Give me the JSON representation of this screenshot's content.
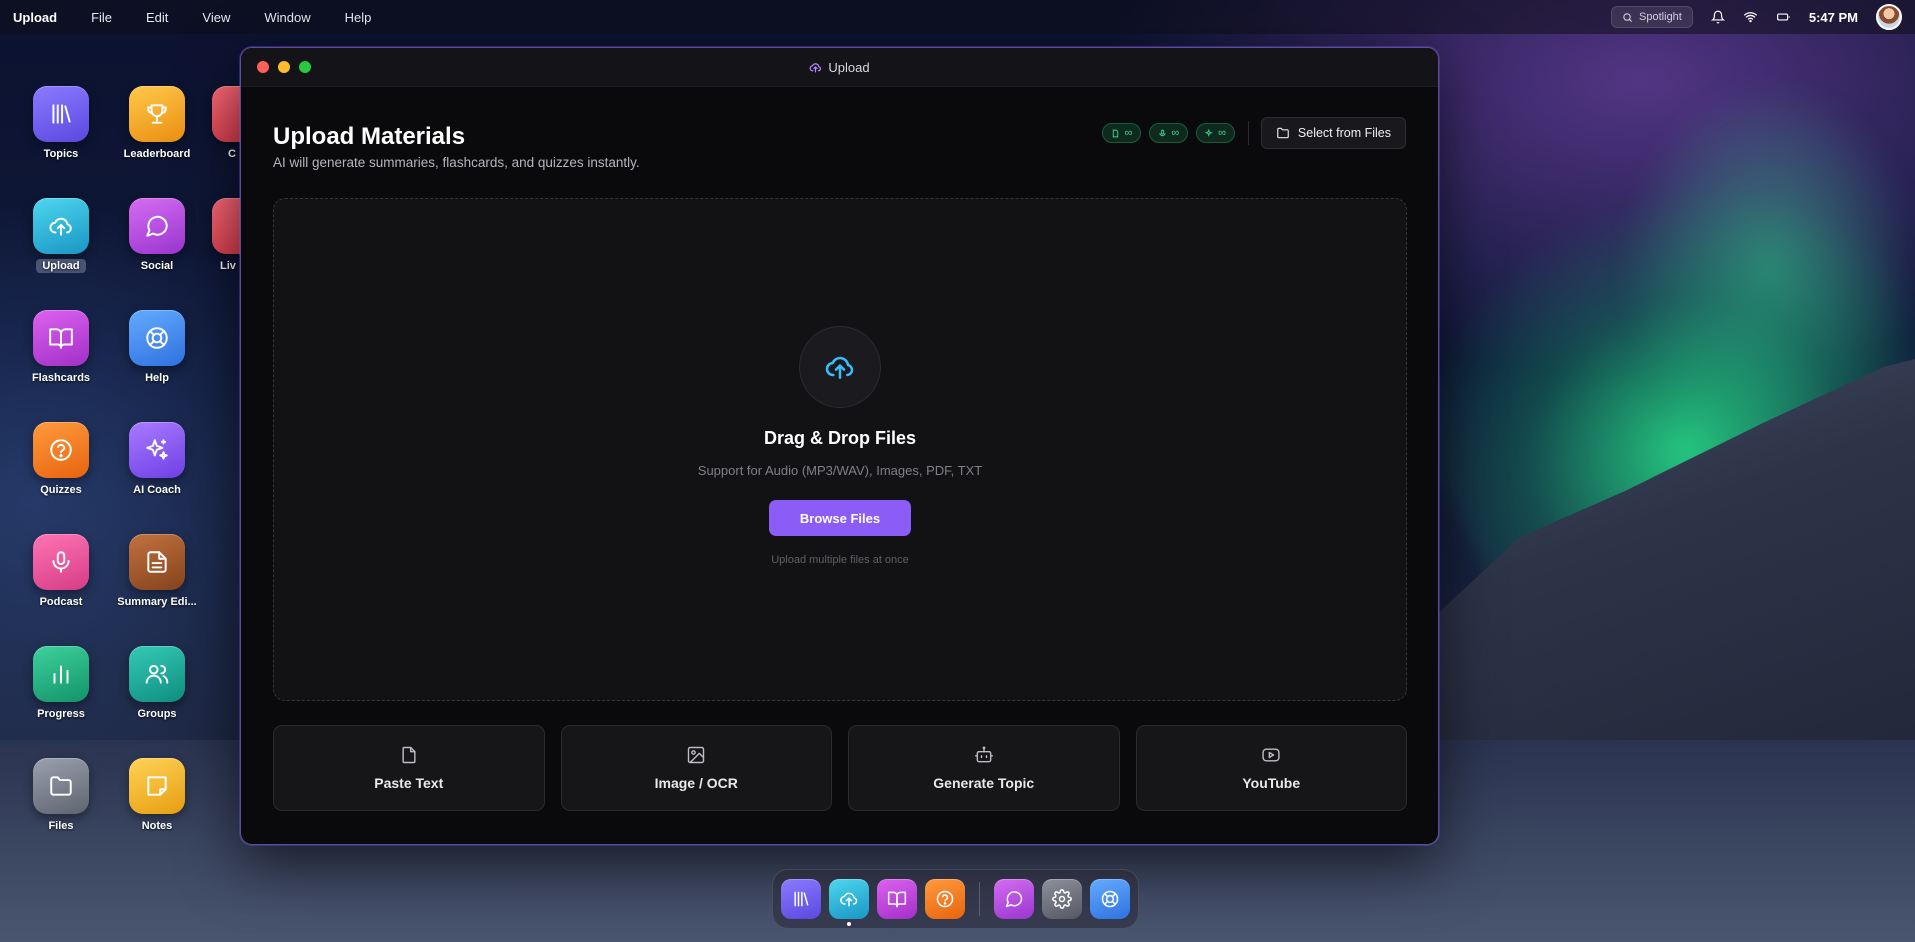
{
  "menubar": {
    "app_name": "Upload",
    "menus": [
      "File",
      "Edit",
      "View",
      "Window",
      "Help"
    ],
    "spotlight_placeholder": "Spotlight",
    "clock": "5:47 PM"
  },
  "desktop_icons": [
    {
      "label": "Topics",
      "icon": "library-icon",
      "color": "#6d5df0"
    },
    {
      "label": "Leaderboard",
      "icon": "trophy-icon",
      "color": "#f2a922"
    },
    {
      "label": "Upload",
      "icon": "cloud-upload-icon",
      "color": "#22b5d9",
      "selected": true
    },
    {
      "label": "Social",
      "icon": "chat-icon",
      "color": "#b84be0"
    },
    {
      "label": "Flashcards",
      "icon": "book-icon",
      "color": "#c045d6"
    },
    {
      "label": "Help",
      "icon": "lifebuoy-icon",
      "color": "#3d8df2"
    },
    {
      "label": "Quizzes",
      "icon": "question-icon",
      "color": "#f27a1f"
    },
    {
      "label": "AI Coach",
      "icon": "sparkles-icon",
      "color": "#8a55f0"
    },
    {
      "label": "Podcast",
      "icon": "microphone-icon",
      "color": "#e8529a"
    },
    {
      "label": "Summary Edi...",
      "icon": "document-icon",
      "color": "#a0582a"
    },
    {
      "label": "Progress",
      "icon": "bar-chart-icon",
      "color": "#1fb083"
    },
    {
      "label": "Groups",
      "icon": "users-icon",
      "color": "#1aa89a"
    },
    {
      "label": "Files",
      "icon": "folder-icon",
      "color": "#7a7f8c"
    },
    {
      "label": "Notes",
      "icon": "note-icon",
      "color": "#f2b62a"
    }
  ],
  "partial_icons": [
    {
      "label": "C",
      "color": "#e04b5a"
    },
    {
      "label": "Liv",
      "color": "#e04b5a"
    }
  ],
  "window": {
    "title": "Upload",
    "heading": "Upload Materials",
    "subheading": "AI will generate summaries, flashcards, and quizzes instantly.",
    "badges": [
      "∞",
      "∞",
      "∞"
    ],
    "select_button": "Select from Files",
    "dropzone": {
      "title": "Drag & Drop Files",
      "subtitle": "Support for Audio (MP3/WAV), Images, PDF, TXT",
      "browse_button": "Browse Files",
      "hint": "Upload multiple files at once"
    },
    "actions": [
      {
        "label": "Paste Text",
        "icon": "file-icon"
      },
      {
        "label": "Image / OCR",
        "icon": "image-icon"
      },
      {
        "label": "Generate Topic",
        "icon": "robot-icon"
      },
      {
        "label": "YouTube",
        "icon": "youtube-icon"
      }
    ]
  },
  "dock": [
    {
      "icon": "library-icon",
      "color": "#6d5df0"
    },
    {
      "icon": "cloud-upload-icon",
      "color": "#22b5d9",
      "active": true
    },
    {
      "icon": "book-icon",
      "color": "#c045d6"
    },
    {
      "icon": "question-icon",
      "color": "#f27a1f"
    },
    {
      "icon": "chat-icon",
      "color": "#b84be0"
    },
    {
      "icon": "gear-icon",
      "color": "#6e717c"
    },
    {
      "icon": "lifebuoy-icon",
      "color": "#3d8df2"
    }
  ],
  "colors": {
    "accent": "#8b5cf6",
    "badge_green": "#3fd68e",
    "window_border": "#5b4aa0"
  }
}
